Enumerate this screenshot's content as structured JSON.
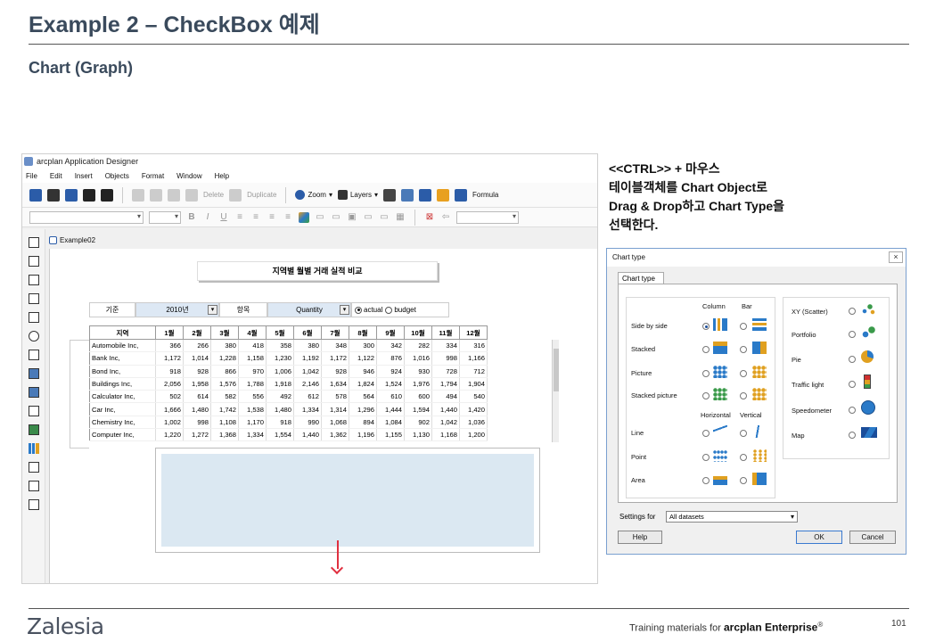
{
  "slide": {
    "title": "Example 2 – CheckBox 예제",
    "subtitle": "Chart (Graph)",
    "instructions": [
      "<<CTRL>> + 마우스",
      "테이블객체를 Chart Object로",
      "Drag & Drop하고 Chart Type을",
      "선택한다."
    ],
    "footer": {
      "logo": "Zalesia",
      "training_prefix": "Training materials for",
      "product": "arcplan Enterprise",
      "reg": "®",
      "page": "101"
    }
  },
  "app": {
    "title": "arcplan Application Designer",
    "menu": [
      "File",
      "Edit",
      "Insert",
      "Objects",
      "Format",
      "Window",
      "Help"
    ],
    "toolbar": {
      "delete": "Delete",
      "duplicate": "Duplicate",
      "zoom": "Zoom",
      "layers": "Layers",
      "formula": "Formula"
    },
    "doc_tab": "Example02",
    "report": {
      "title": "지역별 월별 거래 실적 비교",
      "filter": {
        "label1": "기준",
        "year": "2010년",
        "label2": "항목",
        "measure": "Quantity",
        "opt_actual": "actual",
        "opt_budget": "budget"
      },
      "columns": [
        "지역",
        "1월",
        "2월",
        "3월",
        "4월",
        "5월",
        "6월",
        "7월",
        "8월",
        "9월",
        "10월",
        "11월",
        "12월"
      ],
      "rows": [
        [
          "Automobile Inc,",
          "366",
          "266",
          "380",
          "418",
          "358",
          "380",
          "348",
          "300",
          "342",
          "282",
          "334",
          "316"
        ],
        [
          "Bank Inc,",
          "1,172",
          "1,014",
          "1,228",
          "1,158",
          "1,230",
          "1,192",
          "1,172",
          "1,122",
          "876",
          "1,016",
          "998",
          "1,166"
        ],
        [
          "Bond Inc,",
          "918",
          "928",
          "866",
          "970",
          "1,006",
          "1,042",
          "928",
          "946",
          "924",
          "930",
          "728",
          "712"
        ],
        [
          "Buildings Inc,",
          "2,056",
          "1,958",
          "1,576",
          "1,788",
          "1,918",
          "2,146",
          "1,634",
          "1,824",
          "1,524",
          "1,976",
          "1,794",
          "1,904"
        ],
        [
          "Calculator Inc,",
          "502",
          "614",
          "582",
          "556",
          "492",
          "612",
          "578",
          "564",
          "610",
          "600",
          "494",
          "540"
        ],
        [
          "Car Inc,",
          "1,666",
          "1,480",
          "1,742",
          "1,538",
          "1,480",
          "1,334",
          "1,314",
          "1,296",
          "1,444",
          "1,594",
          "1,440",
          "1,420"
        ],
        [
          "Chemistry Inc,",
          "1,002",
          "998",
          "1,108",
          "1,170",
          "918",
          "990",
          "1,068",
          "894",
          "1,084",
          "902",
          "1,042",
          "1,036"
        ],
        [
          "Computer Inc,",
          "1,220",
          "1,272",
          "1,368",
          "1,334",
          "1,554",
          "1,440",
          "1,362",
          "1,196",
          "1,155",
          "1,130",
          "1,168",
          "1,200"
        ]
      ]
    }
  },
  "dialog": {
    "title": "Chart type",
    "close": "×",
    "tab": "Chart type",
    "col_column": "Column",
    "col_bar": "Bar",
    "col_horizontal": "Horizontal",
    "col_vertical": "Vertical",
    "types_left": [
      "Side by side",
      "Stacked",
      "Picture",
      "Stacked picture",
      "Line",
      "Point",
      "Area"
    ],
    "types_right": [
      "XY (Scatter)",
      "Portfolio",
      "Pie",
      "Traffic light",
      "Speedometer",
      "Map"
    ],
    "settings_label": "Settings for",
    "settings_value": "All datasets",
    "btn_help": "Help",
    "btn_ok": "OK",
    "btn_cancel": "Cancel"
  }
}
